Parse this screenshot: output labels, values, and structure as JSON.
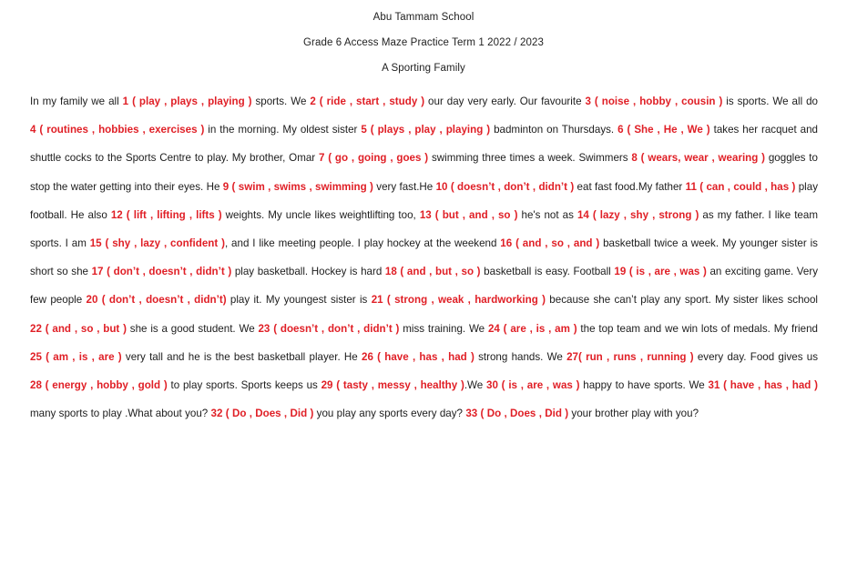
{
  "document": {
    "school": "Abu Tammam School",
    "grade_line": "Grade 6 Access Maze Practice Term 1   2022 / 2023",
    "title": "A Sporting Family",
    "accent_color": "#e01f26",
    "text_color": "#1c1c1c"
  },
  "passage": {
    "segments": [
      {
        "type": "plain",
        "text": "In my family we all  "
      },
      {
        "type": "option",
        "text": "1 ( play , plays , playing )"
      },
      {
        "type": "plain",
        "text": " sports. We  "
      },
      {
        "type": "option",
        "text": "2 ( ride , start , study )"
      },
      {
        "type": "plain",
        "text": " our day very early. Our favourite "
      },
      {
        "type": "option",
        "text": "3 ( noise , hobby , cousin )"
      },
      {
        "type": "plain",
        "text": " is sports. We all do "
      },
      {
        "type": "option",
        "text": "4 ( routines , hobbies , exercises )"
      },
      {
        "type": "plain",
        "text": " in the morning. My oldest sister "
      },
      {
        "type": "option",
        "text": "5 ( plays , play , playing )"
      },
      {
        "type": "plain",
        "text": " badminton on Thursdays. "
      },
      {
        "type": "option",
        "text": "6 ( She , He , We )"
      },
      {
        "type": "plain",
        "text": " takes her racquet and shuttle cocks to the Sports Centre to play. My brother, Omar "
      },
      {
        "type": "option",
        "text": "7 ( go , going , goes )"
      },
      {
        "type": "plain",
        "text": " swimming three times a week. Swimmers "
      },
      {
        "type": "option",
        "text": "8 ( wears, wear , wearing )"
      },
      {
        "type": "plain",
        "text": " goggles to stop the water getting into their eyes. He  "
      },
      {
        "type": "option",
        "text": "9 ( swim , swims , swimming )"
      },
      {
        "type": "plain",
        "text": " very fast.He "
      },
      {
        "type": "option",
        "text": "10  ( doesn’t , don’t , didn’t )"
      },
      {
        "type": "plain",
        "text": " eat fast food.My  father "
      },
      {
        "type": "option",
        "text": "11 ( can , could , has )"
      },
      {
        "type": "plain",
        "text": " play  football.  He  also "
      },
      {
        "type": "option",
        "text": "12 ( lift , lifting , lifts  )"
      },
      {
        "type": "plain",
        "text": " weights.  My  uncle  likes weightlifting too, "
      },
      {
        "type": "option",
        "text": "13 ( but , and , so )"
      },
      {
        "type": "plain",
        "text": " he's not as "
      },
      {
        "type": "option",
        "text": "14 ( lazy , shy , strong )"
      },
      {
        "type": "plain",
        "text": " as my father. I like team sports. I am "
      },
      {
        "type": "option",
        "text": "15 ( shy , lazy , confident )"
      },
      {
        "type": "plain",
        "text": ", and I like meeting people. I play hockey at the weekend "
      },
      {
        "type": "option",
        "text": "16 ( and , so , and )"
      },
      {
        "type": "plain",
        "text": " basketball twice a week. My younger sister is short so she "
      },
      {
        "type": "option",
        "text": "17 ( don’t , doesn’t , didn’t )"
      },
      {
        "type": "plain",
        "text": " play basketball. Hockey is hard "
      },
      {
        "type": "option",
        "text": "18 ( and , but , so )"
      },
      {
        "type": "plain",
        "text": " basketball is easy. Football "
      },
      {
        "type": "option",
        "text": "19 ( is , are , was )"
      },
      {
        "type": "plain",
        "text": " an exciting game. Very few people "
      },
      {
        "type": "option",
        "text": "20 ( don’t , doesn’t , didn’t)"
      },
      {
        "type": "plain",
        "text": " play it. My youngest sister is "
      },
      {
        "type": "option",
        "text": "21 ( strong , weak , hardworking )"
      },
      {
        "type": "plain",
        "text": " because she can’t play any sport. My sister likes school "
      },
      {
        "type": "option",
        "text": "22 ( and , so , but )"
      },
      {
        "type": "plain",
        "text": " she is a good student. We "
      },
      {
        "type": "option",
        "text": "23 ( doesn’t , don’t , didn’t )"
      },
      {
        "type": "plain",
        "text": " miss training. We "
      },
      {
        "type": "option",
        "text": "24 ( are , is , am )"
      },
      {
        "type": "plain",
        "text": " the top team and we win lots of medals. My friend "
      },
      {
        "type": "option",
        "text": "25 ( am , is , are )"
      },
      {
        "type": "plain",
        "text": " very tall and he is the best basketball player. He "
      },
      {
        "type": "option",
        "text": "26 ( have , has , had )"
      },
      {
        "type": "plain",
        "text": " strong hands.  We  "
      },
      {
        "type": "option",
        "text": "27( run , runs , running )"
      },
      {
        "type": "plain",
        "text": " every day. Food gives us "
      },
      {
        "type": "option",
        "text": "28 ( energy , hobby , gold )"
      },
      {
        "type": "plain",
        "text": " to play sports. Sports keeps us  "
      },
      {
        "type": "option",
        "text": "29 ( tasty , messy , healthy )"
      },
      {
        "type": "plain",
        "text": ".We "
      },
      {
        "type": "option",
        "text": "30 ( is , are , was )"
      },
      {
        "type": "plain",
        "text": " happy to have sports. We "
      },
      {
        "type": "option",
        "text": "31 ( have , has , had )"
      },
      {
        "type": "plain",
        "text": " many sports to play .What about you? "
      },
      {
        "type": "option",
        "text": "32 ( Do , Does , Did )"
      },
      {
        "type": "plain",
        "text": " you play any sports every day? "
      },
      {
        "type": "option",
        "text": "33 ( Do , Does , Did )"
      },
      {
        "type": "plain",
        "text": " your brother play with you?"
      }
    ]
  },
  "questions": [
    {
      "number": 1,
      "options": [
        "play",
        "plays",
        "playing"
      ]
    },
    {
      "number": 2,
      "options": [
        "ride",
        "start",
        "study"
      ]
    },
    {
      "number": 3,
      "options": [
        "noise",
        "hobby",
        "cousin"
      ]
    },
    {
      "number": 4,
      "options": [
        "routines",
        "hobbies",
        "exercises"
      ]
    },
    {
      "number": 5,
      "options": [
        "plays",
        "play",
        "playing"
      ]
    },
    {
      "number": 6,
      "options": [
        "She",
        "He",
        "We"
      ]
    },
    {
      "number": 7,
      "options": [
        "go",
        "going",
        "goes"
      ]
    },
    {
      "number": 8,
      "options": [
        "wears",
        "wear",
        "wearing"
      ]
    },
    {
      "number": 9,
      "options": [
        "swim",
        "swims",
        "swimming"
      ]
    },
    {
      "number": 10,
      "options": [
        "doesn’t",
        "don’t",
        "didn’t"
      ]
    },
    {
      "number": 11,
      "options": [
        "can",
        "could",
        "has"
      ]
    },
    {
      "number": 12,
      "options": [
        "lift",
        "lifting",
        "lifts"
      ]
    },
    {
      "number": 13,
      "options": [
        "but",
        "and",
        "so"
      ]
    },
    {
      "number": 14,
      "options": [
        "lazy",
        "shy",
        "strong"
      ]
    },
    {
      "number": 15,
      "options": [
        "shy",
        "lazy",
        "confident"
      ]
    },
    {
      "number": 16,
      "options": [
        "and",
        "so",
        "and"
      ]
    },
    {
      "number": 17,
      "options": [
        "don’t",
        "doesn’t",
        "didn’t"
      ]
    },
    {
      "number": 18,
      "options": [
        "and",
        "but",
        "so"
      ]
    },
    {
      "number": 19,
      "options": [
        "is",
        "are",
        "was"
      ]
    },
    {
      "number": 20,
      "options": [
        "don’t",
        "doesn’t",
        "didn’t"
      ]
    },
    {
      "number": 21,
      "options": [
        "strong",
        "weak",
        "hardworking"
      ]
    },
    {
      "number": 22,
      "options": [
        "and",
        "so",
        "but"
      ]
    },
    {
      "number": 23,
      "options": [
        "doesn’t",
        "don’t",
        "didn’t"
      ]
    },
    {
      "number": 24,
      "options": [
        "are",
        "is",
        "am"
      ]
    },
    {
      "number": 25,
      "options": [
        "am",
        "is",
        "are"
      ]
    },
    {
      "number": 26,
      "options": [
        "have",
        "has",
        "had"
      ]
    },
    {
      "number": 27,
      "options": [
        "run",
        "runs",
        "running"
      ]
    },
    {
      "number": 28,
      "options": [
        "energy",
        "hobby",
        "gold"
      ]
    },
    {
      "number": 29,
      "options": [
        "tasty",
        "messy",
        "healthy"
      ]
    },
    {
      "number": 30,
      "options": [
        "is",
        "are",
        "was"
      ]
    },
    {
      "number": 31,
      "options": [
        "have",
        "has",
        "had"
      ]
    },
    {
      "number": 32,
      "options": [
        "Do",
        "Does",
        "Did"
      ]
    },
    {
      "number": 33,
      "options": [
        "Do",
        "Does",
        "Did"
      ]
    }
  ]
}
